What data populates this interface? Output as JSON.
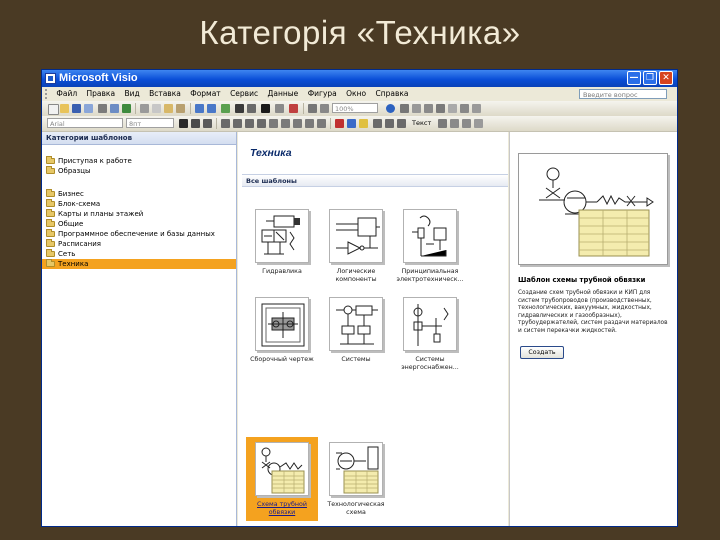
{
  "slide": {
    "title": "Категорія «Техника»"
  },
  "window": {
    "title": "Microsoft Visio"
  },
  "menu": {
    "items": [
      "Файл",
      "Правка",
      "Вид",
      "Вставка",
      "Формат",
      "Сервис",
      "Данные",
      "Фигура",
      "Окно",
      "Справка"
    ],
    "ask_placeholder": "Введите вопрос"
  },
  "toolbar": {
    "zoom": "100%",
    "font": "Arial",
    "font_size": "8пт",
    "text_label": "Текст"
  },
  "left_pane": {
    "header": "Категории шаблонов",
    "items": [
      "Приступая к работе",
      "Образцы",
      "Бизнес",
      "Блок-схема",
      "Карты и планы этажей",
      "Общие",
      "Программное обеспечение и базы данных",
      "Расписания",
      "Сеть",
      "Техника"
    ],
    "selected": "Техника"
  },
  "main": {
    "title": "Техника",
    "section": "Все шаблоны",
    "templates": [
      {
        "label": "Гидравлика",
        "icon": "hydraulics-icon"
      },
      {
        "label": "Логические компоненты",
        "icon": "logic-components-icon"
      },
      {
        "label": "Принципиальная электротехническ...",
        "icon": "electrical-schematic-icon"
      },
      {
        "label": "Сборочный чертеж",
        "icon": "assembly-drawing-icon"
      },
      {
        "label": "Системы",
        "icon": "systems-icon"
      },
      {
        "label": "Системы энергоснабжен...",
        "icon": "power-systems-icon"
      },
      {
        "label": "Схема трубной обвязки",
        "icon": "piping-diagram-icon",
        "selected": true
      },
      {
        "label": "Технологическая схема",
        "icon": "process-flow-icon"
      }
    ]
  },
  "preview": {
    "title": "Шаблон схемы трубной обвязки",
    "description": "Создание схем трубной обвязки и КИП для систем трубопроводов (производственных, технологических, вакуумных, жидкостных, гидравлических и газообразных), трубоудержателей, систем раздачи материалов и систем перекачки жидкостей.",
    "create_button": "Создать"
  },
  "colors": {
    "title_text": "#f2ead6",
    "slide_bg": "#4a3a24",
    "selection": "#f4a21f",
    "titlebar": "#0b4fd8"
  }
}
